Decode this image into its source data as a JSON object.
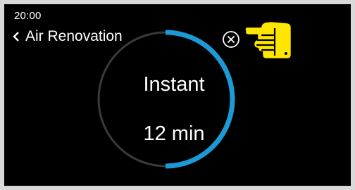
{
  "status_bar": {
    "time": "20:00"
  },
  "header": {
    "back_icon": "chevron-left-icon",
    "title": "Air Renovation"
  },
  "timer": {
    "mode": "Instant",
    "duration": "12 min",
    "progress_fraction": 0.5,
    "progress_color": "#1b9ad6",
    "track_color": "#3a3a3a"
  },
  "actions": {
    "close_icon": "close-circle-icon"
  },
  "overlay": {
    "pointer_icon": "pointing-hand-icon",
    "pointer_color": "#ffe600"
  }
}
